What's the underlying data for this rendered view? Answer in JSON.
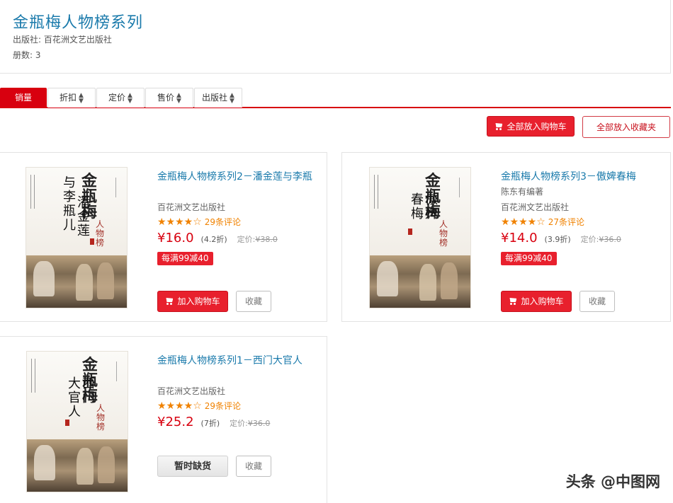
{
  "header": {
    "title": "金瓶梅人物榜系列",
    "publisher_label": "出版社: 百花洲文艺出版社",
    "count_label": "册数: 3"
  },
  "sort_tabs": [
    {
      "label": "销量",
      "active": true
    },
    {
      "label": "折扣"
    },
    {
      "label": "定价"
    },
    {
      "label": "售价"
    },
    {
      "label": "出版社"
    }
  ],
  "actions": {
    "add_all_cart": "全部放入购物车",
    "add_all_fav": "全部放入收藏夹"
  },
  "books": [
    {
      "title": "金瓶梅人物榜系列2－潘金莲与李瓶",
      "author": "",
      "publisher": "百花洲文艺出版社",
      "stars": "★★★★☆",
      "rating": 4.5,
      "reviews": "29条评论",
      "price": "¥16.0",
      "discount": "(4.2折)",
      "list_label": "定价:",
      "list_price": "¥38.0",
      "promo": "每满99减40",
      "cart_label": "加入购物车",
      "fav_label": "收藏",
      "cover_calli": "金瓶梅",
      "cover_sub": "人物榜",
      "cover_vert1": "潘金莲",
      "cover_vert2": "与李瓶儿"
    },
    {
      "title": "金瓶梅人物榜系列3－傲婢春梅",
      "author": "陈东有编著",
      "publisher": "百花洲文艺出版社",
      "stars": "★★★★☆",
      "rating": 4.5,
      "reviews": "27条评论",
      "price": "¥14.0",
      "discount": "(3.9折)",
      "list_label": "定价:",
      "list_price": "¥36.0",
      "promo": "每满99减40",
      "cart_label": "加入购物车",
      "fav_label": "收藏",
      "cover_calli": "金瓶梅",
      "cover_sub": "人物榜",
      "cover_vert1": "傲婢",
      "cover_vert2": "春梅"
    },
    {
      "title": "金瓶梅人物榜系列1－西门大官人",
      "author": "",
      "publisher": "百花洲文艺出版社",
      "stars": "★★★★☆",
      "rating": 4.5,
      "reviews": "29条评论",
      "price": "¥25.2",
      "discount": "(7折)",
      "list_label": "定价:",
      "list_price": "¥36.0",
      "promo": "",
      "out_of_stock_label": "暂时缺货",
      "fav_label": "收藏",
      "cover_calli": "金瓶梅",
      "cover_sub": "人物榜",
      "cover_vert1": "西门",
      "cover_vert2": "大官人"
    }
  ],
  "watermark": "头条 @中图网",
  "colors": {
    "accent_red": "#d8000f",
    "title_blue": "#1a7aab",
    "star_orange": "#f08200"
  }
}
